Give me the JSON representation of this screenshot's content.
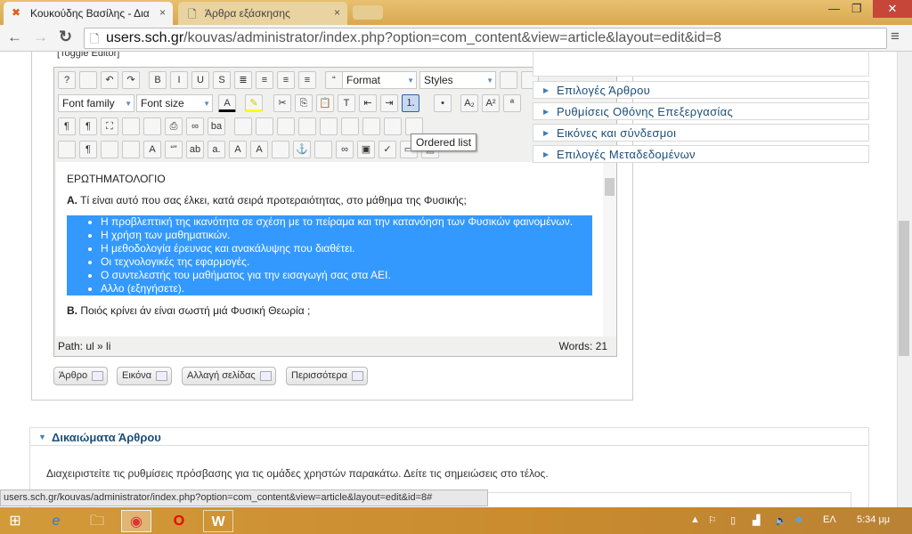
{
  "browser": {
    "tabs": [
      {
        "title": "Κουκούδης Βασίλης - Δια",
        "active": true
      },
      {
        "title": "Άρθρα εξάσκησης",
        "active": false
      }
    ],
    "url_host": "users.sch.gr",
    "url_path": "/kouvas/administrator/index.php?option=com_content&view=article&layout=edit&id=8",
    "status_url": "users.sch.gr/kouvas/administrator/index.php?option=com_content&view=article&layout=edit&id=8#"
  },
  "editor": {
    "toggle": "[Toggle Editor]",
    "format": "Format",
    "styles": "Styles",
    "font_family": "Font family",
    "font_size": "Font size",
    "tooltip": "Ordered list",
    "toolbar_rows": [
      [
        "help-icon",
        "new-document-icon",
        "undo-icon",
        "redo-icon",
        "bold-icon",
        "italic-icon",
        "underline-icon",
        "strikethrough-icon",
        "justify-full-icon",
        "align-center-icon",
        "align-left-icon",
        "align-right-icon",
        "blockquote-icon"
      ],
      [
        "cut-icon",
        "copy-icon",
        "paste-icon",
        "paste-text-icon",
        "outdent-icon",
        "indent-icon",
        "ordered-list-icon",
        "unordered-list-icon",
        "subscript-icon",
        "superscript-icon",
        "charmap-icon"
      ],
      [
        "ltr-icon",
        "rtl-icon",
        "fullscreen-icon",
        "preview-icon",
        "code-icon",
        "print-icon",
        "search-binoculars-icon",
        "replace-icon",
        "table-icon",
        "delete-table-icon",
        "row-props-icon",
        "cell-props-icon",
        "insert-row-before-icon",
        "insert-row-after-icon",
        "delete-row-icon",
        "merge-cells-icon",
        "split-cells-icon"
      ],
      [
        "visual-aid-icon",
        "show-blocks-icon",
        "template-icon",
        "pagebreak-icon",
        "styleprops-icon",
        "cite-icon",
        "abbr-icon",
        "acronym-icon",
        "del-icon",
        "ins-icon",
        "attribs-icon",
        "anchor-icon",
        "unlink-icon",
        "link-icon",
        "image-icon",
        "spellcheck-icon",
        "hr-icon",
        "layer-icon"
      ]
    ],
    "heading": "ΕΡΩΤΗΜΑΤΟΛΟΓΙΟ",
    "qA_label": "Α.",
    "qA": "Τί είναι αυτό που σας έλκει, κατά σειρά προτεραιότητας, στο μάθημα της Φυσικής;",
    "items": [
      "Η προβλεπτική της ικανότητα σε σχέση με το πείραμα και την κατανόηση των Φυσικών φαινομένων.",
      "Η χρήση των μαθηματικών.",
      "Η μεθοδολογία έρευνας και ανακάλυψης που διαθέτει.",
      "Οι τεχνολογικές της εφαρμογές.",
      "Ο συντελεστής του μαθήματος για την εισαγωγή σας στα ΑΕΙ.",
      "Αλλο (εξηγήσετε)."
    ],
    "qB_label": "Β.",
    "qB": "Ποιός κρίνει άν είναι σωστή μιά Φυσική Θεωρία ;",
    "path": "Path:  ul » li",
    "words": "Words: 21",
    "buttons": [
      "Άρθρο",
      "Εικόνα",
      "Αλλαγή σελίδας",
      "Περισσότερα"
    ]
  },
  "panels": [
    "Επιλογές Άρθρου",
    "Ρυθμίσεις Οθόνης Επεξεργασίας",
    "Εικόνες και σύνδεσμοι",
    "Επιλογές Μεταδεδομένων"
  ],
  "permissions": {
    "title": "Δικαιώματα Άρθρου",
    "text": "Διαχειριστείτε τις ρυθμίσεις πρόσβασης για τις ομάδες χρηστών παρακάτω. Δείτε τις σημειώσεις στο τέλος."
  },
  "taskbar": {
    "language": "ΕΛ",
    "time": "5:34 μμ"
  }
}
